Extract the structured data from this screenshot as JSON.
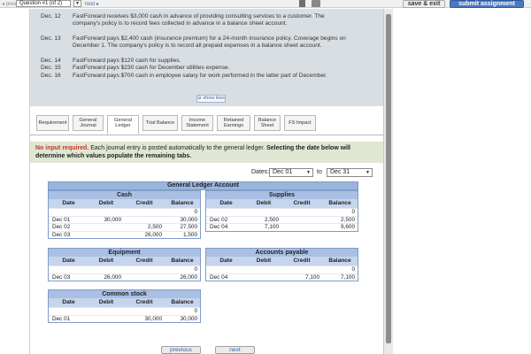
{
  "topbar": {
    "prev": "◂ prev",
    "question_select": "Question #1 (of 2)",
    "next": "next ▸",
    "save": "save & exit",
    "submit": "submit assignment"
  },
  "problem": {
    "items": [
      {
        "date": "Dec. 12",
        "text": "FastForward receives $3,000 cash in advance of providing consulting services to a customer. The company's policy is to record fees collected in advance in a balance sheet account."
      },
      {
        "date": "Dec. 13",
        "text": "FastForward pays $2,400 cash (insurance premium) for a 24-month insurance policy. Coverage begins on December 1. The company's policy is to record all prepaid expenses in a balance sheet account."
      },
      {
        "date": "Dec. 14",
        "text": "FastForward pays $120 cash for supplies."
      },
      {
        "date": "Dec. 15",
        "text": "FastForward pays $230 cash for December utilities expense."
      },
      {
        "date": "Dec. 16",
        "text": "FastForward pays $700 cash in employee salary for work performed in the latter part of December."
      }
    ],
    "show_less": "show less"
  },
  "tabs": [
    {
      "label": "Requirement"
    },
    {
      "label": "General Journal"
    },
    {
      "label": "General Ledger"
    },
    {
      "label": "Trial Balance"
    },
    {
      "label": "Income Statement"
    },
    {
      "label": "Retained Earnings"
    },
    {
      "label": "Balance Sheet"
    },
    {
      "label": "FS Impact"
    }
  ],
  "notice": {
    "red": "No input required.",
    "mid": " Each journal entry is posted automatically to the general ledger. ",
    "bold": "Selecting the date below will determine which values populate the remaining tabs."
  },
  "dates": {
    "label": "Dates:",
    "from": "Dec 01",
    "to_label": "to",
    "to": "Dec 31"
  },
  "ledger": {
    "title": "General Ledger Account",
    "columns": {
      "date": "Date",
      "debit": "Debit",
      "credit": "Credit",
      "balance": "Balance"
    },
    "accounts": {
      "cash": {
        "name": "Cash",
        "rows": [
          {
            "date": "",
            "debit": "",
            "credit": "",
            "balance": "0"
          },
          {
            "date": "Dec 01",
            "debit": "30,000",
            "credit": "",
            "balance": "30,000"
          },
          {
            "date": "Dec 02",
            "debit": "",
            "credit": "2,500",
            "balance": "27,500"
          },
          {
            "date": "Dec 03",
            "debit": "",
            "credit": "26,000",
            "balance": "1,500"
          }
        ]
      },
      "supplies": {
        "name": "Supplies",
        "rows": [
          {
            "date": "",
            "debit": "",
            "credit": "",
            "balance": "0"
          },
          {
            "date": "Dec 02",
            "debit": "2,500",
            "credit": "",
            "balance": "2,500"
          },
          {
            "date": "Dec 04",
            "debit": "7,100",
            "credit": "",
            "balance": "9,600"
          }
        ]
      },
      "equipment": {
        "name": "Equipment",
        "rows": [
          {
            "date": "",
            "debit": "",
            "credit": "",
            "balance": "0"
          },
          {
            "date": "Dec 03",
            "debit": "26,000",
            "credit": "",
            "balance": "26,000"
          }
        ]
      },
      "payable": {
        "name": "Accounts payable",
        "rows": [
          {
            "date": "",
            "debit": "",
            "credit": "",
            "balance": "0"
          },
          {
            "date": "Dec 04",
            "debit": "",
            "credit": "7,100",
            "balance": "7,100"
          }
        ]
      },
      "stock": {
        "name": "Common stock",
        "rows": [
          {
            "date": "",
            "debit": "",
            "credit": "",
            "balance": "0"
          },
          {
            "date": "Dec 01",
            "debit": "",
            "credit": "30,000",
            "balance": "30,000"
          }
        ]
      }
    }
  },
  "nav": {
    "previous": "previous",
    "next": "next"
  }
}
